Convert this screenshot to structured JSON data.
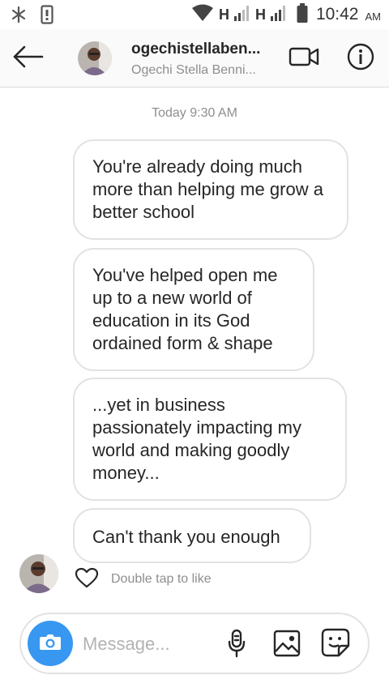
{
  "status_bar": {
    "network_1": "H",
    "network_2": "H",
    "time": "10:42",
    "ampm": "AM",
    "icons": [
      "snowflake-icon",
      "notification-icon",
      "wifi-icon",
      "signal-icon",
      "battery-icon"
    ]
  },
  "header": {
    "username": "ogechistellaben...",
    "full_name": "Ogechi Stella Benni...",
    "icons": [
      "back-arrow-icon",
      "video-call-icon",
      "info-icon"
    ]
  },
  "thread": {
    "timestamp": "Today 9:30 AM",
    "messages": [
      "You're already doing much more than helping me grow a better school",
      "You've helped open me up to a new world of education in its God ordained form & shape",
      "...yet in business passionately impacting my world and making goodly money...",
      "Can't thank you enough"
    ],
    "like_hint": "Double tap to like"
  },
  "composer": {
    "placeholder": "Message...",
    "accent_color": "#3897f0",
    "icons": [
      "camera-icon",
      "microphone-icon",
      "gallery-icon",
      "sticker-icon"
    ]
  }
}
